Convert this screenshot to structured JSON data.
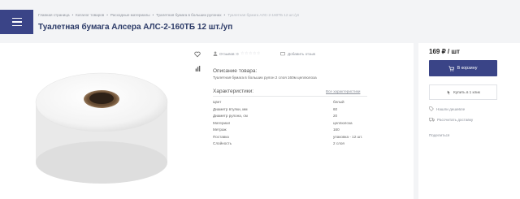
{
  "header": {
    "breadcrumb": [
      "Главная страница",
      "Каталог товаров",
      "Расходные материалы",
      "Туалетная бумага в больших рулонах"
    ],
    "breadcrumb_current": "Туалетная бумага АЛС-2-160ТБ 12 шт./уп",
    "separator": "•"
  },
  "product": {
    "title": "Туалетная бумага Алсера АЛС-2-160ТБ 12 шт./уп",
    "reviews_label": "Отзывов: 0",
    "stars": "☆☆☆☆☆",
    "add_review": "Добавить отзыв",
    "description_heading": "Описание товара:",
    "description": "Туалетная бумага в больших рулон 2 слоя 160м целлюлоза",
    "specs_heading": "Характеристики:",
    "all_specs_link": "Все характеристики",
    "specs": [
      {
        "key": "Цвет",
        "value": "белый"
      },
      {
        "key": "Диаметр втулки, мм",
        "value": "60"
      },
      {
        "key": "Диаметр рулона, см",
        "value": "20"
      },
      {
        "key": "Материал",
        "value": "целлюлоза"
      },
      {
        "key": "Метраж",
        "value": "160"
      },
      {
        "key": "Поставка",
        "value": "упаковка - 12 шт."
      },
      {
        "key": "Слойность",
        "value": "2 слоя"
      }
    ]
  },
  "purchase": {
    "price": "169 ₽ / шт",
    "cart_button": "В корзину",
    "one_click_button": "Купить в 1 клик",
    "cheaper_link": "Нашли дешевле",
    "delivery_link": "Рассчитать доставку",
    "share_label": "Поделиться"
  },
  "colors": {
    "accent": "#3a4487",
    "title": "#2b3a67"
  }
}
